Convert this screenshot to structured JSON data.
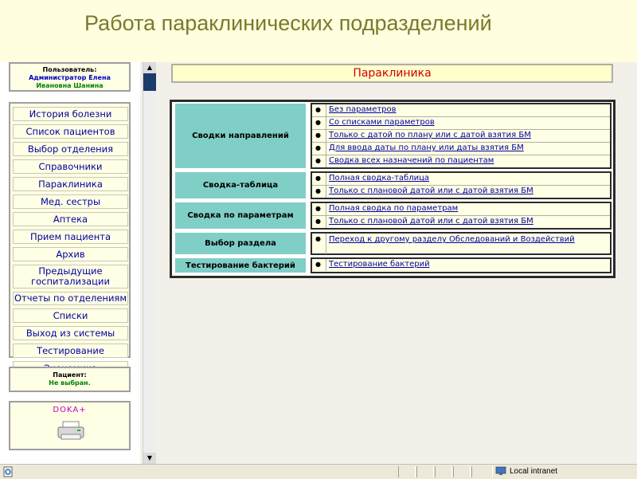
{
  "slide": {
    "title": "Работа параклинических подразделений"
  },
  "user": {
    "label": "Пользователь:",
    "role": "Администратор Елена",
    "name": "Ивановна Шанина"
  },
  "menu": [
    {
      "label": "История болезни"
    },
    {
      "label": "Список пациентов"
    },
    {
      "label": "Выбор отделения"
    },
    {
      "label": "Справочники"
    },
    {
      "label": "Параклиника"
    },
    {
      "label": "Мед. сестры"
    },
    {
      "label": "Аптека"
    },
    {
      "label": "Прием пациента"
    },
    {
      "label": "Архив"
    },
    {
      "label": "Предыдущие госпитализации"
    },
    {
      "label": "Отчеты по отделениям"
    },
    {
      "label": "Списки"
    },
    {
      "label": "Выход из системы"
    },
    {
      "label": "Тестирование"
    },
    {
      "label": "Экономика"
    }
  ],
  "patient": {
    "label": "Пациент:",
    "value": "Не выбран."
  },
  "logo": {
    "text": "DOKA+"
  },
  "main": {
    "header": "Параклиника",
    "sections": [
      {
        "category": "Сводки направлений",
        "options": [
          "Без параметров",
          "Со списками параметров",
          "Только с датой по плану или с датой взятия БМ",
          "Для ввода даты по плану или даты взятия БМ",
          "Сводка всех назначений по пациентам"
        ]
      },
      {
        "category": "Сводка-таблица",
        "options": [
          "Полная сводка-таблица",
          "Только с плановой датой или с датой взятия БМ"
        ]
      },
      {
        "category": "Сводка по параметрам",
        "options": [
          "Полная сводка по параметрам",
          "Только с плановой датой или с датой взятия БМ"
        ]
      },
      {
        "category": "Выбор раздела",
        "options": [
          "Переход к другому разделу Обследований и Воздействий"
        ]
      },
      {
        "category": "Тестирование бактерий",
        "options": [
          "Тестирование бактерий"
        ]
      }
    ]
  },
  "statusbar": {
    "zone": "Local intranet"
  },
  "icons": {
    "bullet": "bullet-icon",
    "scroll_up": "arrow-up-icon",
    "scroll_down": "arrow-down-icon",
    "printer": "printer-icon",
    "globe": "globe-icon",
    "ie": "page-icon"
  },
  "colors": {
    "accent_teal": "#80cfc6",
    "link": "#0000a0",
    "header_red": "#d00000",
    "title_olive": "#7a7a2a"
  }
}
